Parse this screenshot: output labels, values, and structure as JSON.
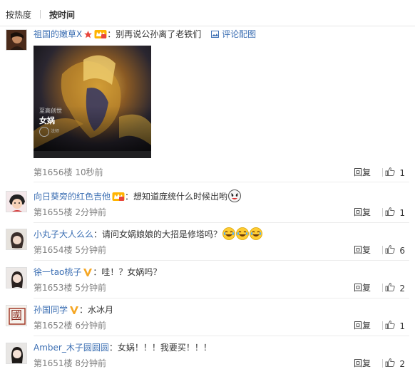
{
  "sort": {
    "by_hot": "按热度",
    "by_time": "按时间"
  },
  "comments": [
    {
      "user": "祖国的嫩草X",
      "text": "：别再说公孙离了老铁们",
      "pic_link": "评论配图",
      "image": {
        "caption_top": "至高创世",
        "caption_name": "女娲",
        "caption_small": "法师"
      },
      "floor": "第1656楼",
      "time": "10秒前",
      "reply": "回复",
      "likes": "1"
    },
    {
      "user": "向日葵旁的红色吉他",
      "text": "：想知道庞统什么时候出哟",
      "floor": "第1655楼",
      "time": "2分钟前",
      "reply": "回复",
      "likes": "1"
    },
    {
      "user": "小丸子大人么么",
      "text": "：请问女娲娘娘的大招是修塔吗？",
      "floor": "第1654楼",
      "time": "5分钟前",
      "reply": "回复",
      "likes": "6"
    },
    {
      "user": "徐一tao桃子",
      "text": "：哇！？女娲吗？",
      "floor": "第1653楼",
      "time": "5分钟前",
      "reply": "回复",
      "likes": "2"
    },
    {
      "user": "孙国同学",
      "text": "：水冰月",
      "avatar_char": "國",
      "floor": "第1652楼",
      "time": "6分钟前",
      "reply": "回复",
      "likes": "1"
    },
    {
      "user": "Amber_木子圆圆圆",
      "text": "：女娲！！！我要买！！！",
      "floor": "第1651楼",
      "time": "8分钟前",
      "reply": "回复",
      "likes": "2"
    }
  ],
  "colors": {
    "username": "#eb7350",
    "link": "#3c6fb3",
    "meta": "#808080"
  },
  "icons": [
    "star-icon",
    "vip-crown-icon",
    "verified-v-icon",
    "picture-icon",
    "thumbs-up-icon",
    "laugh-emoji-icon",
    "cheeky-emoji-icon"
  ]
}
